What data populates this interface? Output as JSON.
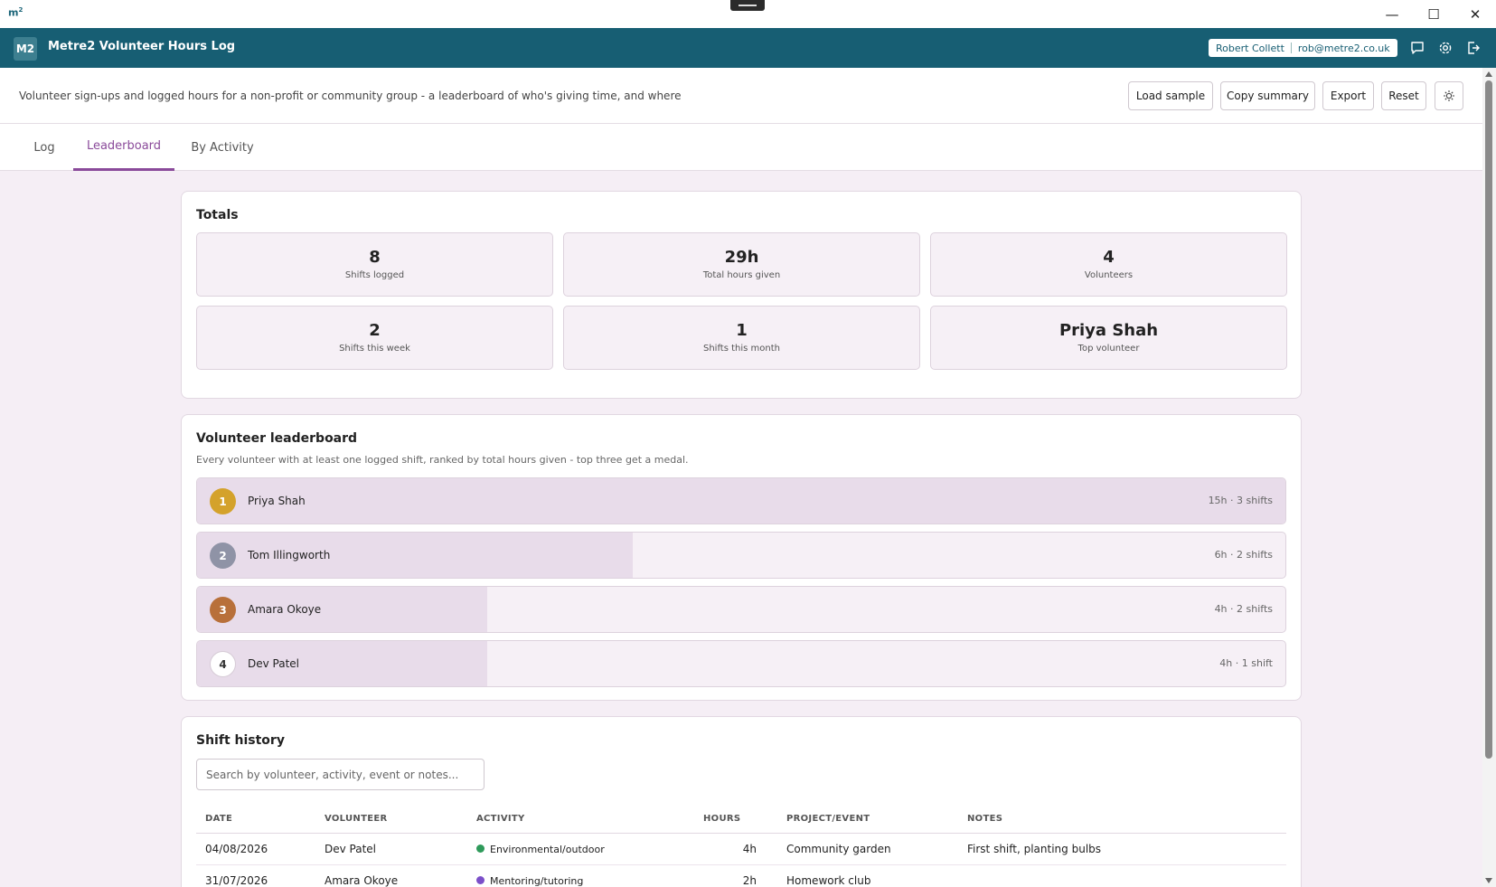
{
  "window": {
    "logo": "m",
    "logo_sup": "2",
    "minimize": "—",
    "maximize": "☐",
    "close": "✕"
  },
  "app": {
    "badge": "M2",
    "title": "Metre2 Volunteer Hours Log",
    "user_name": "Robert Collett",
    "user_email": "rob@metre2.co.uk",
    "icons": [
      "chat-icon",
      "gear-icon",
      "logout-icon"
    ]
  },
  "toolbar": {
    "description": "Volunteer sign-ups and logged hours for a non-profit or community group - a leaderboard of who's giving time, and where",
    "load_sample": "Load sample",
    "copy_summary": "Copy summary",
    "export": "Export",
    "reset": "Reset"
  },
  "tabs": [
    {
      "label": "Log",
      "active": false
    },
    {
      "label": "Leaderboard",
      "active": true
    },
    {
      "label": "By Activity",
      "active": false
    }
  ],
  "totals": {
    "title": "Totals",
    "stats": [
      {
        "value": "8",
        "label": "Shifts logged"
      },
      {
        "value": "29h",
        "label": "Total hours given"
      },
      {
        "value": "4",
        "label": "Volunteers"
      },
      {
        "value": "2",
        "label": "Shifts this week"
      },
      {
        "value": "1",
        "label": "Shifts this month"
      },
      {
        "value": "Priya Shah",
        "label": "Top volunteer"
      }
    ]
  },
  "leaderboard": {
    "title": "Volunteer leaderboard",
    "subtitle": "Every volunteer with at least one logged shift, ranked by total hours given - top three get a medal.",
    "rows": [
      {
        "rank": "1",
        "name": "Priya Shah",
        "meta": "15h · 3 shifts",
        "hours": 15,
        "medal_color": "#d4a22b"
      },
      {
        "rank": "2",
        "name": "Tom Illingworth",
        "meta": "6h · 2 shifts",
        "hours": 6,
        "medal_color": "#8f93a6"
      },
      {
        "rank": "3",
        "name": "Amara Okoye",
        "meta": "4h · 2 shifts",
        "hours": 4,
        "medal_color": "#b8703a"
      },
      {
        "rank": "4",
        "name": "Dev Patel",
        "meta": "4h · 1 shift",
        "hours": 4,
        "medal_color": "#ffffff"
      }
    ]
  },
  "history": {
    "title": "Shift history",
    "search_placeholder": "Search by volunteer, activity, event or notes...",
    "columns": [
      "DATE",
      "VOLUNTEER",
      "ACTIVITY",
      "HOURS",
      "PROJECT/EVENT",
      "NOTES"
    ],
    "rows": [
      {
        "date": "04/08/2026",
        "volunteer": "Dev Patel",
        "activity": "Environmental/outdoor",
        "activity_color": "#2e9a5a",
        "hours": "4h",
        "project": "Community garden",
        "notes": "First shift, planting bulbs"
      },
      {
        "date": "31/07/2026",
        "volunteer": "Amara Okoye",
        "activity": "Mentoring/tutoring",
        "activity_color": "#7b4fc9",
        "hours": "2h",
        "project": "Homework club",
        "notes": ""
      }
    ]
  }
}
